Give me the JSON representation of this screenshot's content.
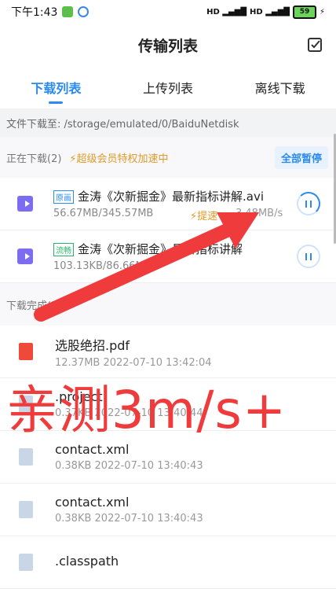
{
  "status": {
    "time": "下午1:43",
    "battery": "59"
  },
  "header": {
    "title": "传输列表"
  },
  "tabs": [
    {
      "label": "下载列表",
      "active": true
    },
    {
      "label": "上传列表",
      "active": false
    },
    {
      "label": "离线下载",
      "active": false
    }
  ],
  "path": "文件下载至: /storage/emulated/0/BaiduNetdisk",
  "downloading": {
    "heading": "正在下载(2)",
    "promo": "⚡超级会员特权加速中",
    "pause_all": "全部暂停",
    "items": [
      {
        "tag": "原画",
        "name": "金涛《次新掘金》最新指标讲解.avi",
        "size": "56.67MB/345.57MB",
        "boost": "⚡提速",
        "speed": "3.48MB/s"
      },
      {
        "tag": "流畅",
        "name": "金涛《次新掘金》最新指标讲解",
        "size": "103.13KB/86.66MB"
      }
    ]
  },
  "completed": {
    "heading": "下载完成(24)",
    "items": [
      {
        "name": "选股绝招.pdf",
        "meta": "12.37MB 2022-07-10 13:42:04"
      },
      {
        "name": ".project",
        "meta": "0.37KB 2022-07-10 13:40:44"
      },
      {
        "name": "contact.xml",
        "meta": "0.38KB 2022-07-10 13:40:43"
      },
      {
        "name": "contact.xml",
        "meta": "0.38KB 2022-07-10 13:40:43"
      },
      {
        "name": ".classpath",
        "meta": ""
      }
    ]
  },
  "overlay": {
    "text": "亲测3m/s+"
  }
}
